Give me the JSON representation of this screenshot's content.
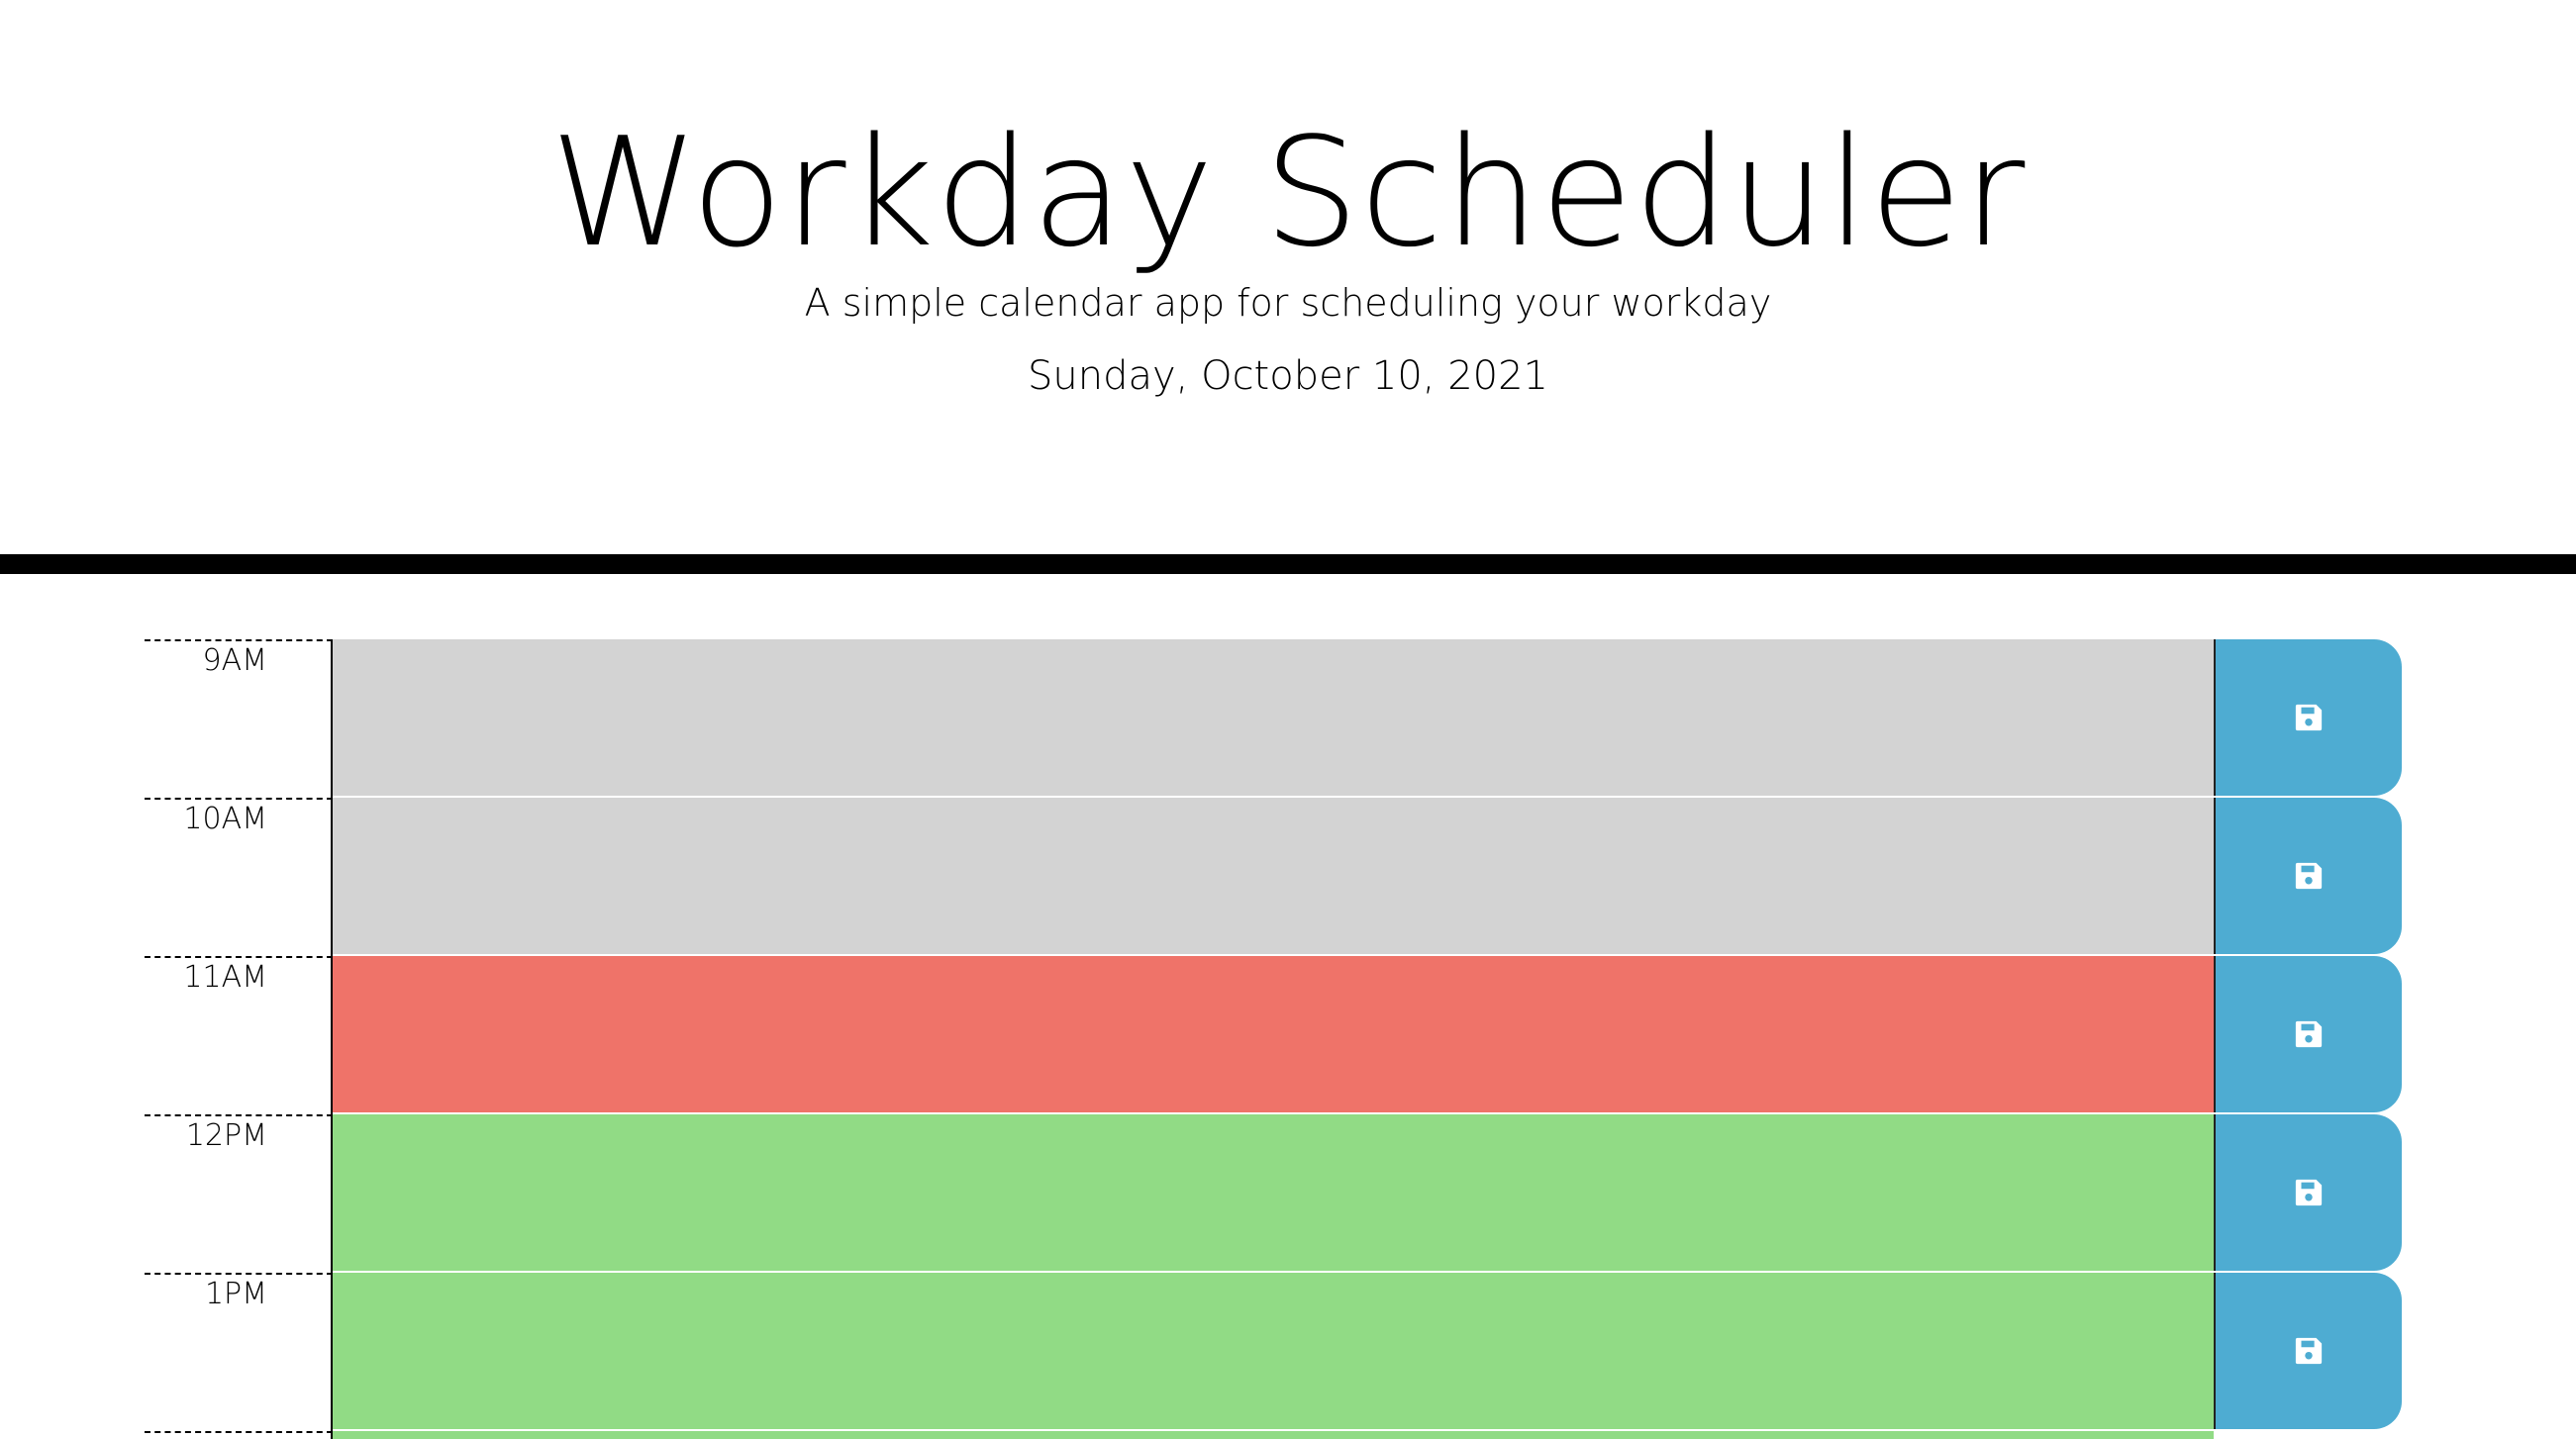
{
  "header": {
    "title": "Workday Scheduler",
    "subtitle": "A simple calendar app for scheduling your workday",
    "current_day": "Sunday, October 10, 2021"
  },
  "time_blocks": [
    {
      "hour": "9AM",
      "status": "past",
      "text": ""
    },
    {
      "hour": "10AM",
      "status": "past",
      "text": ""
    },
    {
      "hour": "11AM",
      "status": "present",
      "text": ""
    },
    {
      "hour": "12PM",
      "status": "future",
      "text": ""
    },
    {
      "hour": "1PM",
      "status": "future",
      "text": ""
    }
  ],
  "icons": {
    "save": "floppy-disk-icon"
  },
  "colors": {
    "past": "#d3d3d3",
    "present": "#ef7369",
    "future": "#91db85",
    "save_button": "#4eacd2",
    "divider": "#000000"
  }
}
